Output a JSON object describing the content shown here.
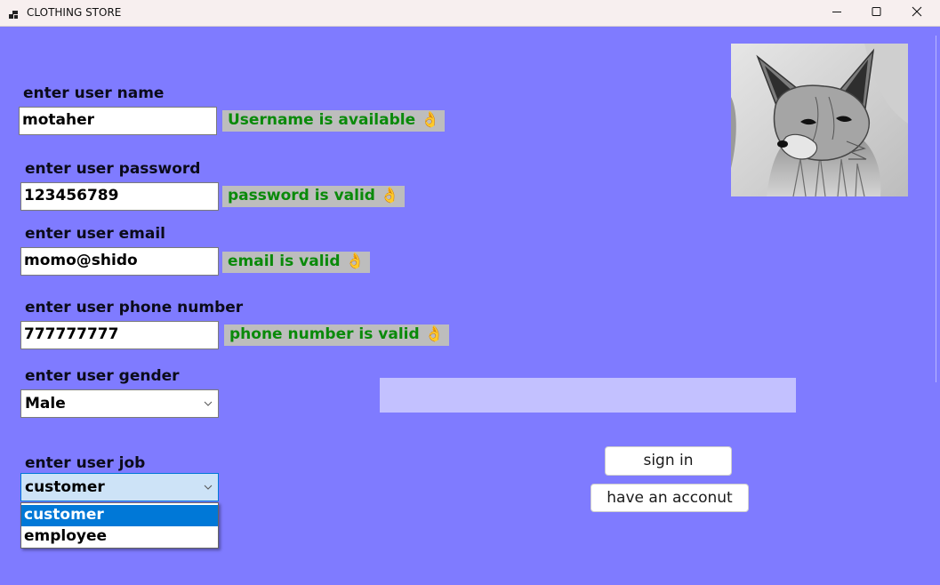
{
  "window": {
    "title": "CLOTHING STORE",
    "icon": "app-form-icon",
    "controls": [
      "minimize-icon",
      "maximize-icon",
      "close-icon"
    ]
  },
  "form": {
    "username": {
      "label": "enter user name",
      "value": "motaher",
      "status": "Username is available 👌"
    },
    "password": {
      "label": "enter user password",
      "value": "123456789",
      "status": "password is valid 👌"
    },
    "email": {
      "label": "enter user email",
      "value": "momo@shido",
      "status": "email is valid 👌"
    },
    "phone": {
      "label": "enter user phone number",
      "value": "777777777",
      "status": "phone number is valid 👌"
    },
    "gender": {
      "label": "enter user gender",
      "selected": "Male"
    },
    "job": {
      "label": "enter user job",
      "selected": "customer",
      "options": [
        "customer",
        "employee"
      ],
      "highlighted_option": "customer"
    }
  },
  "progress": {
    "value_percent": 0
  },
  "buttons": {
    "sign_in": "sign in",
    "have_account": "have an acconut"
  },
  "picture": {
    "subject": "fox-illustration",
    "style": "grayscale"
  },
  "colors": {
    "background": "#7f7bff",
    "status_text": "#0a8a0a",
    "status_bg": "#bdbdbd",
    "selection": "#0078d7"
  }
}
